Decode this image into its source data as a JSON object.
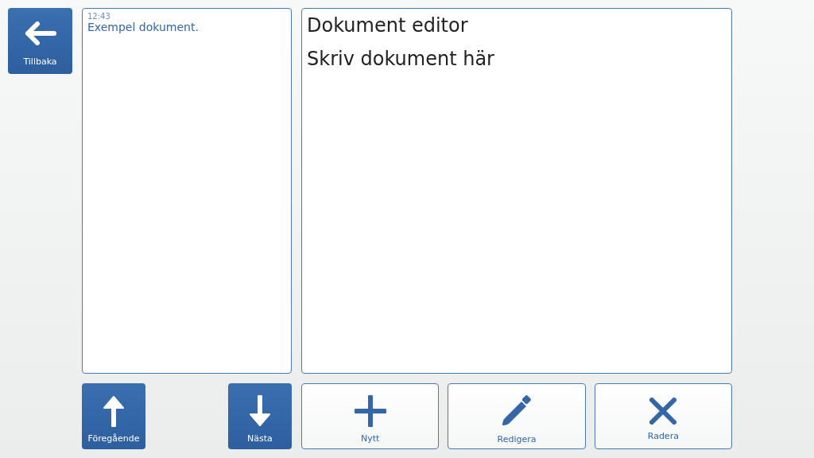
{
  "back_button": {
    "label": "Tillbaka"
  },
  "documents": [
    {
      "time": "12:43",
      "text": "Exempel dokument."
    }
  ],
  "editor": {
    "lines": [
      "Dokument editor",
      "Skriv dokument här"
    ]
  },
  "nav_buttons": [
    {
      "label": "Föregående"
    },
    {
      "label": "Nästa"
    }
  ],
  "action_buttons": [
    {
      "label": "Nytt"
    },
    {
      "label": "Redigera"
    },
    {
      "label": "Radera"
    }
  ]
}
